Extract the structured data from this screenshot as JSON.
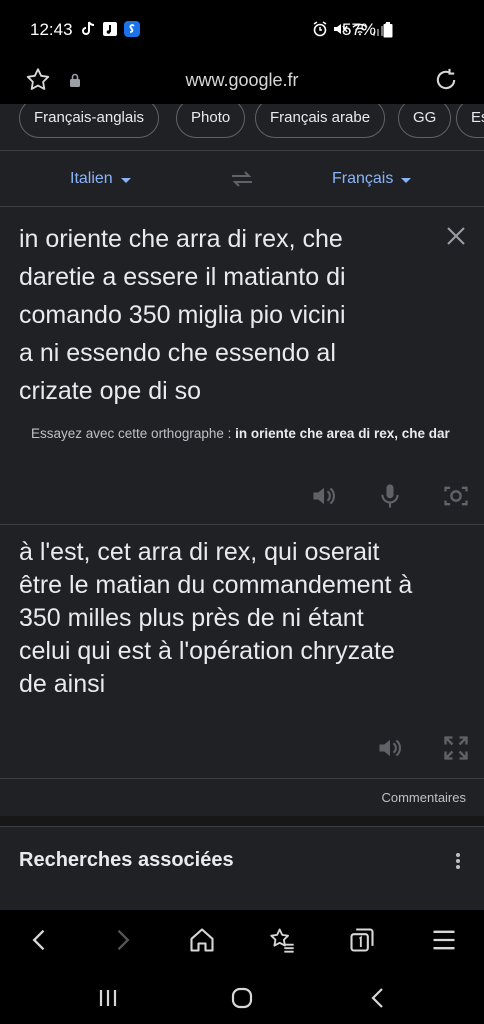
{
  "status_bar": {
    "time": "12:43",
    "battery": "57%",
    "left_icons": [
      "tiktok-icon",
      "notes-icon",
      "shazam-icon"
    ],
    "right_icons": [
      "alarm-icon",
      "mute-icon",
      "wifi-icon",
      "signal-icon",
      "battery-icon"
    ]
  },
  "address_bar": {
    "url": "www.google.fr"
  },
  "chips": [
    {
      "label": "Français-anglais"
    },
    {
      "label": "Photo"
    },
    {
      "label": "Français arabe"
    },
    {
      "label": "GG"
    },
    {
      "label": "Es"
    }
  ],
  "translator": {
    "source_lang": "Italien",
    "target_lang": "Français",
    "source_lines": [
      "in oriente che arra di rex, che",
      "daretie a essere il matianto di",
      "comando 350 miglia pio vicini",
      "a ni essendo che essendo al",
      "crizate ope di so"
    ],
    "suggestion_prefix": "Essayez avec cette orthographe :",
    "suggestion_text": "in oriente che area di rex, che dar",
    "target_lines": [
      "à l'est, cet arra di rex, qui oserait",
      "être le matian du commandement à",
      "350 milles plus près de ni étant",
      "celui qui est à l'opération chryzate",
      "de ainsi"
    ],
    "feedback_label": "Commentaires"
  },
  "related": {
    "title": "Recherches associées"
  },
  "colors": {
    "accent": "#8ab4f8",
    "card_bg": "#202124",
    "divider": "#3c4043"
  }
}
